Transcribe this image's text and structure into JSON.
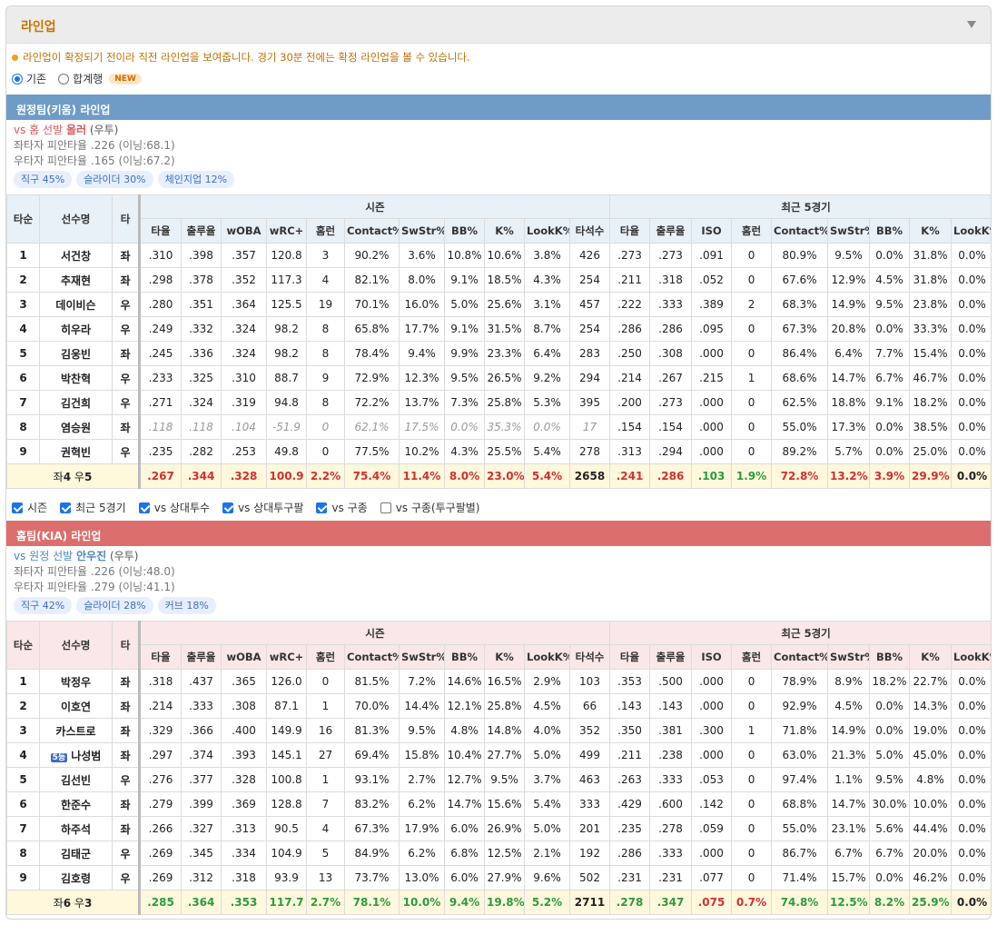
{
  "panel": {
    "title": "라인업"
  },
  "notice": "라인업이 확정되기 전이라 직전 라인업을 보여줍니다. 경기 30분 전에는 확정 라인업을 볼 수 있습니다.",
  "view_options": {
    "selected": "기존",
    "options": [
      "기존",
      "합계행"
    ],
    "new_badge": "NEW"
  },
  "headers": {
    "order": "타순",
    "name": "선수명",
    "hand": "타",
    "season": "시즌",
    "recent": "최근 5경기",
    "season_cols": [
      "타율",
      "출루율",
      "wOBA",
      "wRC+",
      "홈런",
      "Contact%",
      "SwStr%",
      "BB%",
      "K%",
      "LookK%",
      "타석수"
    ],
    "recent_cols": [
      "타율",
      "출루율",
      "ISO",
      "홈런",
      "Contact%",
      "SwStr%",
      "BB%",
      "K%",
      "LookK%"
    ]
  },
  "away": {
    "bar": "원정팀(키움) 라인업",
    "vs_prefix": "vs 홈 선발",
    "pitcher": "올러",
    "pitcher_hand": "(우투)",
    "vs_left": "좌타자 피안타율 .226 (이닝:68.1)",
    "vs_right": "우타자 피안타율 .165 (이닝:67.2)",
    "pitches": [
      "직구 45%",
      "슬라이더 30%",
      "체인지업 12%"
    ],
    "rows": [
      {
        "o": "1",
        "n": "서건창",
        "h": "좌",
        "s": [
          ".310",
          ".398",
          ".357",
          "120.8",
          "3",
          "90.2%",
          "3.6%",
          "10.8%",
          "10.6%",
          "3.8%",
          "426"
        ],
        "r": [
          ".273",
          ".273",
          ".091",
          "0",
          "80.9%",
          "9.5%",
          "0.0%",
          "31.8%",
          "0.0%"
        ]
      },
      {
        "o": "2",
        "n": "추재현",
        "h": "좌",
        "s": [
          ".298",
          ".378",
          ".352",
          "117.3",
          "4",
          "82.1%",
          "8.0%",
          "9.1%",
          "18.5%",
          "4.3%",
          "254"
        ],
        "r": [
          ".211",
          ".318",
          ".052",
          "0",
          "67.6%",
          "12.9%",
          "4.5%",
          "31.8%",
          "0.0%"
        ]
      },
      {
        "o": "3",
        "n": "데이비슨",
        "h": "우",
        "s": [
          ".280",
          ".351",
          ".364",
          "125.5",
          "19",
          "70.1%",
          "16.0%",
          "5.0%",
          "25.6%",
          "3.1%",
          "457"
        ],
        "r": [
          ".222",
          ".333",
          ".389",
          "2",
          "68.3%",
          "14.9%",
          "9.5%",
          "23.8%",
          "0.0%"
        ]
      },
      {
        "o": "4",
        "n": "히우라",
        "h": "우",
        "s": [
          ".249",
          ".332",
          ".324",
          "98.2",
          "8",
          "65.8%",
          "17.7%",
          "9.1%",
          "31.5%",
          "8.7%",
          "254"
        ],
        "r": [
          ".286",
          ".286",
          ".095",
          "0",
          "67.3%",
          "20.8%",
          "0.0%",
          "33.3%",
          "0.0%"
        ]
      },
      {
        "o": "5",
        "n": "김웅빈",
        "h": "좌",
        "s": [
          ".245",
          ".336",
          ".324",
          "98.2",
          "8",
          "78.4%",
          "9.4%",
          "9.9%",
          "23.3%",
          "6.4%",
          "283"
        ],
        "r": [
          ".250",
          ".308",
          ".000",
          "0",
          "86.4%",
          "6.4%",
          "7.7%",
          "15.4%",
          "0.0%"
        ]
      },
      {
        "o": "6",
        "n": "박찬혁",
        "h": "우",
        "s": [
          ".233",
          ".325",
          ".310",
          "88.7",
          "9",
          "72.9%",
          "12.3%",
          "9.5%",
          "26.5%",
          "9.2%",
          "294"
        ],
        "r": [
          ".214",
          ".267",
          ".215",
          "1",
          "68.6%",
          "14.7%",
          "6.7%",
          "46.7%",
          "0.0%"
        ]
      },
      {
        "o": "7",
        "n": "김건희",
        "h": "우",
        "s": [
          ".271",
          ".324",
          ".319",
          "94.8",
          "8",
          "72.2%",
          "13.7%",
          "7.3%",
          "25.8%",
          "5.3%",
          "395"
        ],
        "r": [
          ".200",
          ".273",
          ".000",
          "0",
          "62.5%",
          "18.8%",
          "9.1%",
          "18.2%",
          "0.0%"
        ]
      },
      {
        "o": "8",
        "n": "염승원",
        "h": "좌",
        "dim": true,
        "s": [
          ".118",
          ".118",
          ".104",
          "-51.9",
          "0",
          "62.1%",
          "17.5%",
          "0.0%",
          "35.3%",
          "0.0%",
          "17"
        ],
        "r": [
          ".154",
          ".154",
          ".000",
          "0",
          "55.0%",
          "17.3%",
          "0.0%",
          "38.5%",
          "0.0%"
        ]
      },
      {
        "o": "9",
        "n": "권혁빈",
        "h": "우",
        "s": [
          ".235",
          ".282",
          ".253",
          "49.8",
          "0",
          "77.5%",
          "10.2%",
          "4.3%",
          "25.5%",
          "5.4%",
          "278"
        ],
        "r": [
          ".313",
          ".294",
          ".000",
          "0",
          "89.2%",
          "5.7%",
          "0.0%",
          "25.0%",
          "0.0%"
        ]
      }
    ],
    "total": {
      "lefts_label": "좌",
      "lefts": "4",
      "rights_label": "우",
      "rights": "5",
      "s": [
        ".267",
        ".344",
        ".328",
        "100.9",
        "2.2%",
        "75.4%",
        "11.4%",
        "8.0%",
        "23.0%",
        "5.4%",
        "2658"
      ],
      "r": [
        ".241",
        ".286",
        ".103",
        "1.9%",
        "72.8%",
        "13.2%",
        "3.9%",
        "29.9%",
        "0.0%"
      ],
      "sc": [
        "r",
        "r",
        "r",
        "r",
        "r",
        "r",
        "r",
        "r",
        "r",
        "r",
        "k"
      ],
      "rc": [
        "r",
        "r",
        "g",
        "g",
        "r",
        "r",
        "r",
        "r",
        "k"
      ]
    }
  },
  "filters": [
    {
      "label": "시즌",
      "checked": true
    },
    {
      "label": "최근 5경기",
      "checked": true
    },
    {
      "label": "vs 상대투수",
      "checked": true
    },
    {
      "label": "vs 상대투구팔",
      "checked": true
    },
    {
      "label": "vs 구종",
      "checked": true
    },
    {
      "label": "vs 구종(투구팔별)",
      "checked": false
    }
  ],
  "home": {
    "bar": "홈팀(KIA) 라인업",
    "vs_prefix": "vs 원정 선발",
    "pitcher": "안우진",
    "pitcher_hand": "(우투)",
    "vs_left": "좌타자 피안타율 .226 (이닝:48.0)",
    "vs_right": "우타자 피안타율 .279 (이닝:41.1)",
    "pitches": [
      "직구 42%",
      "슬라이더 28%",
      "커브 18%"
    ],
    "rows": [
      {
        "o": "1",
        "n": "박정우",
        "h": "좌",
        "s": [
          ".318",
          ".437",
          ".365",
          "126.0",
          "0",
          "81.5%",
          "7.2%",
          "14.6%",
          "16.5%",
          "2.9%",
          "103"
        ],
        "r": [
          ".353",
          ".500",
          ".000",
          "0",
          "78.9%",
          "8.9%",
          "18.2%",
          "22.7%",
          "0.0%"
        ]
      },
      {
        "o": "2",
        "n": "이호연",
        "h": "좌",
        "s": [
          ".214",
          ".333",
          ".308",
          "87.1",
          "1",
          "70.0%",
          "14.4%",
          "12.1%",
          "25.8%",
          "4.5%",
          "66"
        ],
        "r": [
          ".143",
          ".143",
          ".000",
          "0",
          "92.9%",
          "4.5%",
          "0.0%",
          "14.3%",
          "0.0%"
        ]
      },
      {
        "o": "3",
        "n": "카스트로",
        "h": "좌",
        "s": [
          ".329",
          ".366",
          ".400",
          "149.9",
          "16",
          "81.3%",
          "9.5%",
          "4.8%",
          "14.8%",
          "4.0%",
          "352"
        ],
        "r": [
          ".350",
          ".381",
          ".300",
          "1",
          "71.8%",
          "14.9%",
          "0.0%",
          "19.0%",
          "0.0%"
        ]
      },
      {
        "o": "4",
        "n": "나성범",
        "h": "좌",
        "rank": "5등",
        "s": [
          ".297",
          ".374",
          ".393",
          "145.1",
          "27",
          "69.4%",
          "15.8%",
          "10.4%",
          "27.7%",
          "5.0%",
          "499"
        ],
        "r": [
          ".211",
          ".238",
          ".000",
          "0",
          "63.0%",
          "21.3%",
          "5.0%",
          "45.0%",
          "0.0%"
        ]
      },
      {
        "o": "5",
        "n": "김선빈",
        "h": "우",
        "s": [
          ".276",
          ".377",
          ".328",
          "100.8",
          "1",
          "93.1%",
          "2.7%",
          "12.7%",
          "9.5%",
          "3.7%",
          "463"
        ],
        "r": [
          ".263",
          ".333",
          ".053",
          "0",
          "97.4%",
          "1.1%",
          "9.5%",
          "4.8%",
          "0.0%"
        ]
      },
      {
        "o": "6",
        "n": "한준수",
        "h": "좌",
        "s": [
          ".279",
          ".399",
          ".369",
          "128.8",
          "7",
          "83.2%",
          "6.2%",
          "14.7%",
          "15.6%",
          "5.4%",
          "333"
        ],
        "r": [
          ".429",
          ".600",
          ".142",
          "0",
          "68.8%",
          "14.7%",
          "30.0%",
          "10.0%",
          "0.0%"
        ]
      },
      {
        "o": "7",
        "n": "하주석",
        "h": "좌",
        "s": [
          ".266",
          ".327",
          ".313",
          "90.5",
          "4",
          "67.3%",
          "17.9%",
          "6.0%",
          "26.9%",
          "5.0%",
          "201"
        ],
        "r": [
          ".235",
          ".278",
          ".059",
          "0",
          "55.0%",
          "23.1%",
          "5.6%",
          "44.4%",
          "0.0%"
        ]
      },
      {
        "o": "8",
        "n": "김태군",
        "h": "우",
        "s": [
          ".269",
          ".345",
          ".334",
          "104.9",
          "5",
          "84.9%",
          "6.2%",
          "6.8%",
          "12.5%",
          "2.1%",
          "192"
        ],
        "r": [
          ".286",
          ".333",
          ".000",
          "0",
          "86.7%",
          "6.7%",
          "6.7%",
          "20.0%",
          "0.0%"
        ]
      },
      {
        "o": "9",
        "n": "김호령",
        "h": "우",
        "s": [
          ".269",
          ".312",
          ".318",
          "93.9",
          "13",
          "73.7%",
          "13.0%",
          "6.0%",
          "27.9%",
          "9.6%",
          "502"
        ],
        "r": [
          ".231",
          ".231",
          ".077",
          "0",
          "71.4%",
          "15.7%",
          "0.0%",
          "46.2%",
          "0.0%"
        ]
      }
    ],
    "total": {
      "lefts_label": "좌",
      "lefts": "6",
      "rights_label": "우",
      "rights": "3",
      "s": [
        ".285",
        ".364",
        ".353",
        "117.7",
        "2.7%",
        "78.1%",
        "10.0%",
        "9.4%",
        "19.8%",
        "5.2%",
        "2711"
      ],
      "r": [
        ".278",
        ".347",
        ".075",
        "0.7%",
        "74.8%",
        "12.5%",
        "8.2%",
        "25.9%",
        "0.0%"
      ],
      "sc": [
        "g",
        "g",
        "g",
        "g",
        "g",
        "g",
        "g",
        "g",
        "g",
        "g",
        "k"
      ],
      "rc": [
        "g",
        "g",
        "r",
        "r",
        "g",
        "g",
        "g",
        "g",
        "k"
      ]
    }
  },
  "colors": {
    "away_bar": "#6f9cc6",
    "home_bar": "#dd6e6e",
    "title": "#c87400",
    "red": "#d23030",
    "green": "#2e9a3e",
    "total_bg": "#fff8dc"
  }
}
